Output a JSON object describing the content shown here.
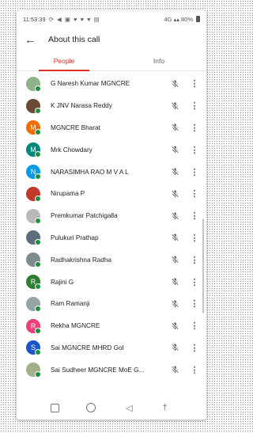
{
  "status_bar": {
    "time": "11:53:39",
    "notification_icons": "⟳ ◀ ▣ ♥ ♥ ♥ ▤",
    "network": "4G",
    "battery": "80%"
  },
  "header": {
    "title": "About this call"
  },
  "tabs": [
    {
      "label": "People",
      "active": true
    },
    {
      "label": "Info",
      "active": false
    }
  ],
  "participants": [
    {
      "name": "G Naresh Kumar MGNCRE",
      "avatar_type": "photo",
      "avatar_color": "#8fb28a",
      "initial": ""
    },
    {
      "name": "K JNV Narasa Reddy",
      "avatar_type": "photo",
      "avatar_color": "#6b4a35",
      "initial": ""
    },
    {
      "name": "MGNCRE Bharat",
      "avatar_type": "initial",
      "avatar_color": "#ef6c00",
      "initial": "M"
    },
    {
      "name": "Mrk Chowdary",
      "avatar_type": "initial",
      "avatar_color": "#00897b",
      "initial": "M"
    },
    {
      "name": "NARASIMHA RAO M V A L",
      "avatar_type": "initial",
      "avatar_color": "#039be5",
      "initial": "N"
    },
    {
      "name": "Nirupama P",
      "avatar_type": "photo",
      "avatar_color": "#c0392b",
      "initial": ""
    },
    {
      "name": "Premkumar Patchigalla",
      "avatar_type": "photo",
      "avatar_color": "#b9b9b9",
      "initial": ""
    },
    {
      "name": "Pulukuri Prathap",
      "avatar_type": "photo",
      "avatar_color": "#5d6d7e",
      "initial": ""
    },
    {
      "name": "Radhakrishna Radha",
      "avatar_type": "photo",
      "avatar_color": "#7f8c8d",
      "initial": ""
    },
    {
      "name": "Rajini G",
      "avatar_type": "initial",
      "avatar_color": "#2e7d32",
      "initial": "R"
    },
    {
      "name": "Ram Ramanji",
      "avatar_type": "photo",
      "avatar_color": "#95a5a6",
      "initial": ""
    },
    {
      "name": "Rekha MGNCRE",
      "avatar_type": "initial",
      "avatar_color": "#ec407a",
      "initial": "R"
    },
    {
      "name": "Sai MGNCRE MHRD GoI",
      "avatar_type": "initial",
      "avatar_color": "#1a56c9",
      "initial": "S"
    },
    {
      "name": "Sai Sudheer MGNCRE MoE G...",
      "avatar_type": "photo",
      "avatar_color": "#a3b18a",
      "initial": ""
    }
  ],
  "icons": {
    "muted": "mic-off-icon",
    "more": "more-vert-icon"
  },
  "colors": {
    "accent": "#d93025",
    "online_dot": "#1e8e3e"
  }
}
